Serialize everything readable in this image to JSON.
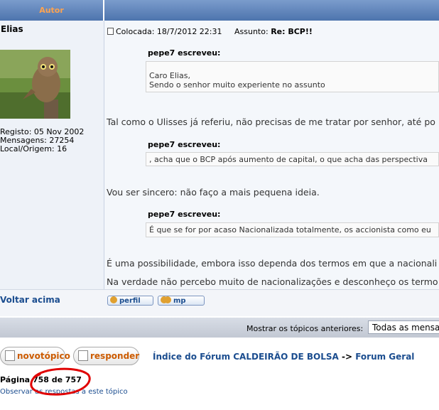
{
  "header": {
    "author_col": "Autor"
  },
  "author": {
    "name": "Elias",
    "registo": "Registo: 05 Nov 2002",
    "mensagens": "Mensagens: 27254",
    "local": "Local/Origem: 16"
  },
  "post": {
    "colocada_label": "Colocada: 18/7/2012 22:31",
    "assunto_label": "Assunto:",
    "assunto_value": "Re: BCP!!",
    "quotes": [
      {
        "author": "pepe7 escreveu:",
        "lines": [
          "Caro Elias,",
          "Sendo o senhor muito experiente no assunto"
        ]
      },
      {
        "author": "pepe7 escreveu:",
        "lines": [
          ", acha que o BCP após aumento de capital, o que acha das perspectiva"
        ]
      },
      {
        "author": "pepe7 escreveu:",
        "lines": [
          "É que se for por acaso Nacionalizada totalmente, os accionista como eu"
        ]
      }
    ],
    "paragraphs": [
      "Tal como o Ulisses já referiu, não precisas de me tratar por senhor, até po",
      "Vou ser sincero: não faço a mais pequena ideia.",
      "É uma possibilidade, embora isso dependa dos termos em que a nacionali",
      "Na verdade não percebo muito de nacionalizações e desconheço os termo"
    ]
  },
  "actions": {
    "voltar": "Voltar acima",
    "perfil": "perfil",
    "mp": "mp"
  },
  "filter": {
    "label": "Mostrar os tópicos anteriores:",
    "selected": "Todas as mensa"
  },
  "buttons": {
    "novo_topico": "novotópico",
    "responder": "responder"
  },
  "nav": {
    "index": "Índice do Fórum CALDEIRÃO DE BOLSA",
    "arrow": "->",
    "forum": "Forum Geral"
  },
  "pagination": {
    "label": "Página",
    "value": "758 de 757",
    "observar": "Observar as respostas a este tópico"
  },
  "colors": {
    "header_blue": "#4d74ad",
    "header_text": "#ffa34f",
    "link": "#1b4d8f",
    "annotation_red": "#e00000"
  }
}
